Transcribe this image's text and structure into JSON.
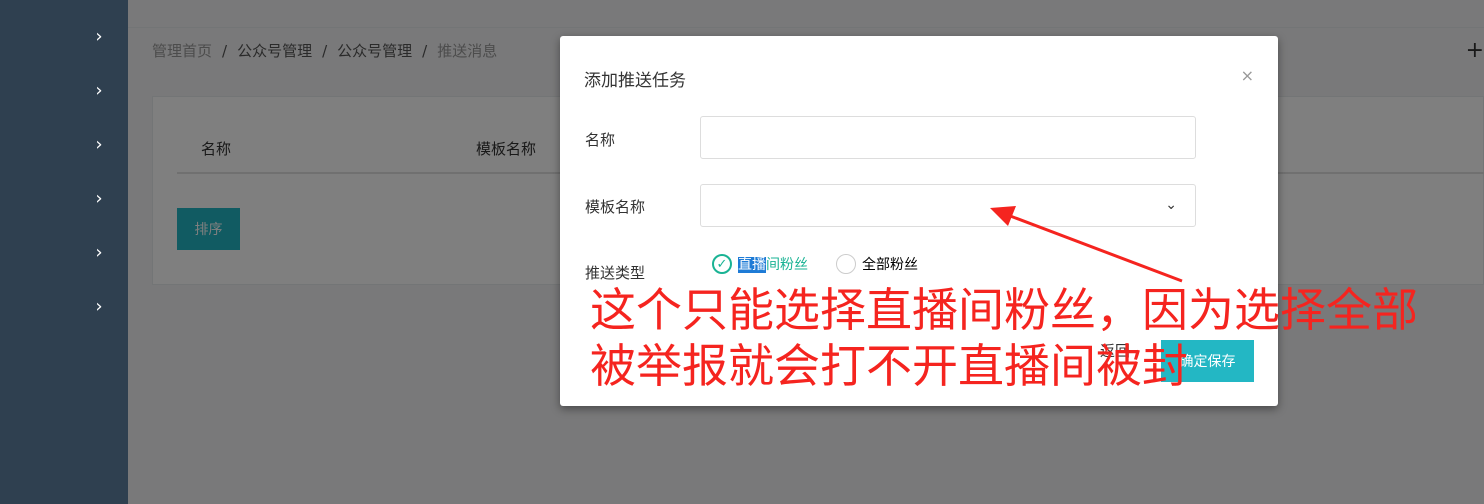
{
  "breadcrumb": [
    "管理首页",
    "公众号管理",
    "公众号管理",
    "推送消息"
  ],
  "breadcrumb_sep": "/",
  "header_plus": "+",
  "table": {
    "headers": [
      "名称",
      "模板名称"
    ],
    "sort_button": "排序"
  },
  "modal": {
    "title": "添加推送任务",
    "close": "×",
    "fields": {
      "name_label": "名称",
      "name_value": "",
      "template_label": "模板名称",
      "template_value": "",
      "push_type_label": "推送类型"
    },
    "radio_options": [
      {
        "label_highlight": "直播",
        "label_rest": "间粉丝",
        "checked": true
      },
      {
        "label": "全部粉丝",
        "checked": false
      }
    ],
    "buttons": {
      "back": "返回",
      "save": "确定保存"
    }
  },
  "annotation_text": [
    "这个只能选择直播间粉丝，因为选择全部",
    "被举报就会打不开直播间被封"
  ],
  "colors": {
    "sidebar": "#2f4050",
    "accent": "#23b7c4",
    "annotation": "#f5241f",
    "checked": "#1ab394"
  }
}
